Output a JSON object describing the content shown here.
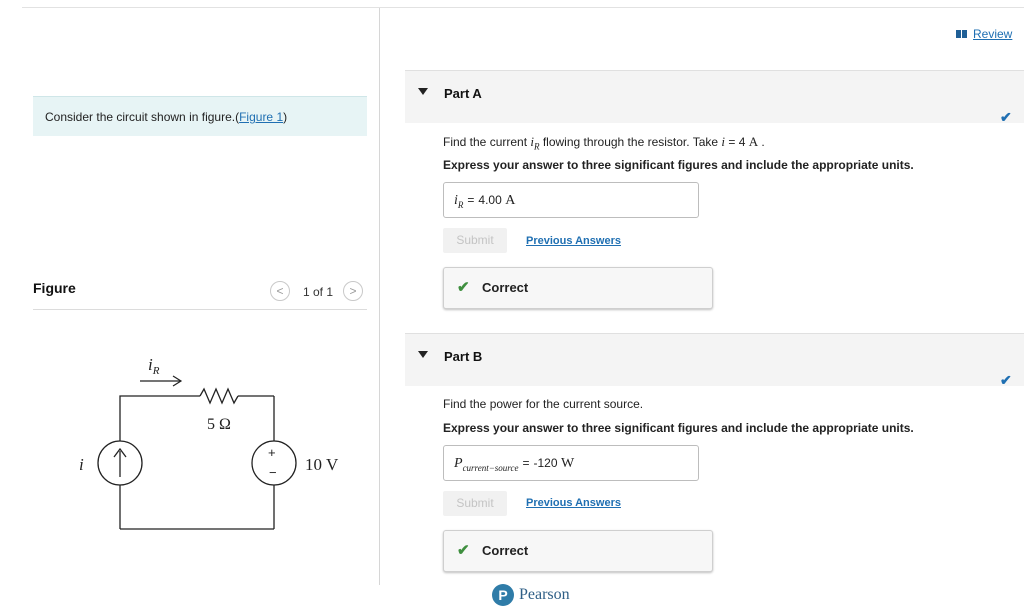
{
  "left": {
    "intro_text": "Consider the circuit shown in figure.(",
    "figure_link": "Figure 1",
    "intro_close": ")",
    "figure_title": "Figure",
    "pager_prev": "<",
    "pager_text": "1 of 1",
    "pager_next": ">",
    "circuit": {
      "current_arrow_label": "i",
      "current_arrow_sub": "R",
      "resistor_label": "5 Ω",
      "source_current_label": "i",
      "voltage_label": "10 V",
      "plus": "+",
      "minus": "−"
    }
  },
  "header": {
    "review_label": "Review"
  },
  "part_a": {
    "title": "Part A",
    "check": "✔",
    "q_prefix": "Find the current ",
    "q_var": "i",
    "q_var_sub": "R",
    "q_mid": " flowing through the resistor. Take ",
    "q_var2": "i",
    "q_eq": " = 4 ",
    "q_unit": "A",
    "q_end": " .",
    "instruction": "Express your answer to three significant figures and include the appropriate units.",
    "answer_label": "i",
    "answer_label_sub": "R",
    "answer_eq": "=",
    "answer_value": "4.00",
    "answer_unit": "A",
    "submit_label": "Submit",
    "previous_answers": "Previous Answers",
    "feedback_icon": "✔",
    "feedback_text": "Correct"
  },
  "part_b": {
    "title": "Part B",
    "check": "✔",
    "question": "Find the power for the current source.",
    "instruction": "Express your answer to three significant figures and include the appropriate units.",
    "answer_label": "P",
    "answer_label_sub": "current−source",
    "answer_eq": "=",
    "answer_value": "-120",
    "answer_unit": "W",
    "submit_label": "Submit",
    "previous_answers": "Previous Answers",
    "feedback_icon": "✔",
    "feedback_text": "Correct"
  },
  "footer": {
    "logo_letter": "P",
    "brand": "Pearson"
  }
}
